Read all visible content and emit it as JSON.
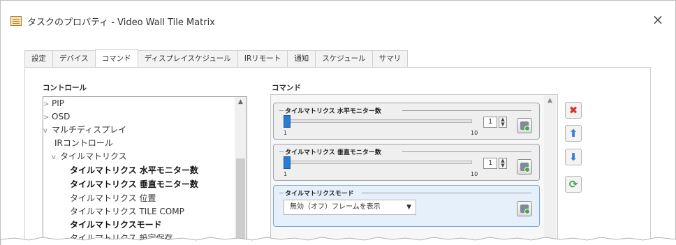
{
  "window": {
    "title": "タスクのプロパティ - Video Wall Tile Matrix",
    "icon": "task-properties-icon",
    "close_glyph": "×"
  },
  "tabs": [
    {
      "label": "設定",
      "active": false
    },
    {
      "label": "デバイス",
      "active": false
    },
    {
      "label": "コマンド",
      "active": true
    },
    {
      "label": "ディスプレイスケジュール",
      "active": false
    },
    {
      "label": "IRリモート",
      "active": false
    },
    {
      "label": "通知",
      "active": false
    },
    {
      "label": "スケジュール",
      "active": false
    },
    {
      "label": "サマリ",
      "active": false
    }
  ],
  "controls": {
    "label": "コントロール",
    "tree": [
      {
        "label": "PIP",
        "arrow": ">",
        "bold": false
      },
      {
        "label": "OSD",
        "arrow": ">",
        "bold": false
      },
      {
        "label": "マルチディスプレイ",
        "arrow": "v",
        "bold": false
      },
      {
        "label": "IRコントロール",
        "arrow": "",
        "bold": false
      },
      {
        "label": "タイルマトリクス",
        "arrow": "v",
        "bold": false
      },
      {
        "label": "タイルマトリクス 水平モニター数",
        "arrow": "",
        "bold": true
      },
      {
        "label": "タイルマトリクス 垂直モニター数",
        "arrow": "",
        "bold": true
      },
      {
        "label": "タイルマトリクス 位置",
        "arrow": "",
        "bold": false
      },
      {
        "label": "タイルマトリクス TILE COMP",
        "arrow": "",
        "bold": false
      },
      {
        "label": "タイルマトリクスモード",
        "arrow": "",
        "bold": true
      },
      {
        "label": "タイルマトリクス 設定保存",
        "arrow": "",
        "bold": false
      }
    ]
  },
  "commands": {
    "label": "コマンド",
    "items": [
      {
        "legend": "タイルマトリクス 水平モニター数",
        "value": "1",
        "min": "1",
        "max": "10",
        "level": 0
      },
      {
        "legend": "タイルマトリクス 垂直モニター数",
        "value": "1",
        "min": "1",
        "max": "10",
        "level": 0
      },
      {
        "legend": "タイルマトリクスモード",
        "selected": "無効（オフ）フレームを表示",
        "is_selected": true
      }
    ]
  },
  "side_buttons": [
    "delete-icon",
    "move-up-icon",
    "move-down-icon",
    "refresh-icon"
  ],
  "colors": {
    "slider_thumb": "#2a7bd4",
    "delete": "#d9342b",
    "arrow": "#3a7fd6",
    "send": "#3fa84a",
    "selected_bg": "#e6f0fa"
  }
}
